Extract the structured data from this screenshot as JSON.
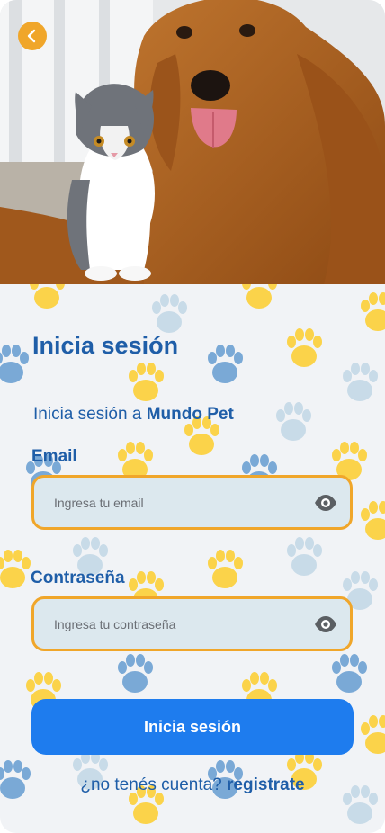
{
  "hero": {
    "image_name": "dog-and-cat-photo"
  },
  "header": {
    "back_icon": "chevron-left-icon"
  },
  "login": {
    "title": "Inicia sesión",
    "subtitle_prefix": "Inicia sesión a ",
    "brand": "Mundo Pet",
    "email": {
      "label": "Email",
      "placeholder": "Ingresa tu email",
      "icon": "eye-icon"
    },
    "password": {
      "label": "Contraseña",
      "placeholder": "Ingresa tu contraseña",
      "icon": "eye-icon"
    },
    "submit_label": "Inicia sesión",
    "register_prompt": "¿no tenés cuenta? ",
    "register_link": "registrate"
  },
  "colors": {
    "accent": "#f0a62a",
    "primary": "#1e7cee",
    "text": "#1f5ea8",
    "background": "#f1f3f6",
    "field": "#dce8ee"
  }
}
